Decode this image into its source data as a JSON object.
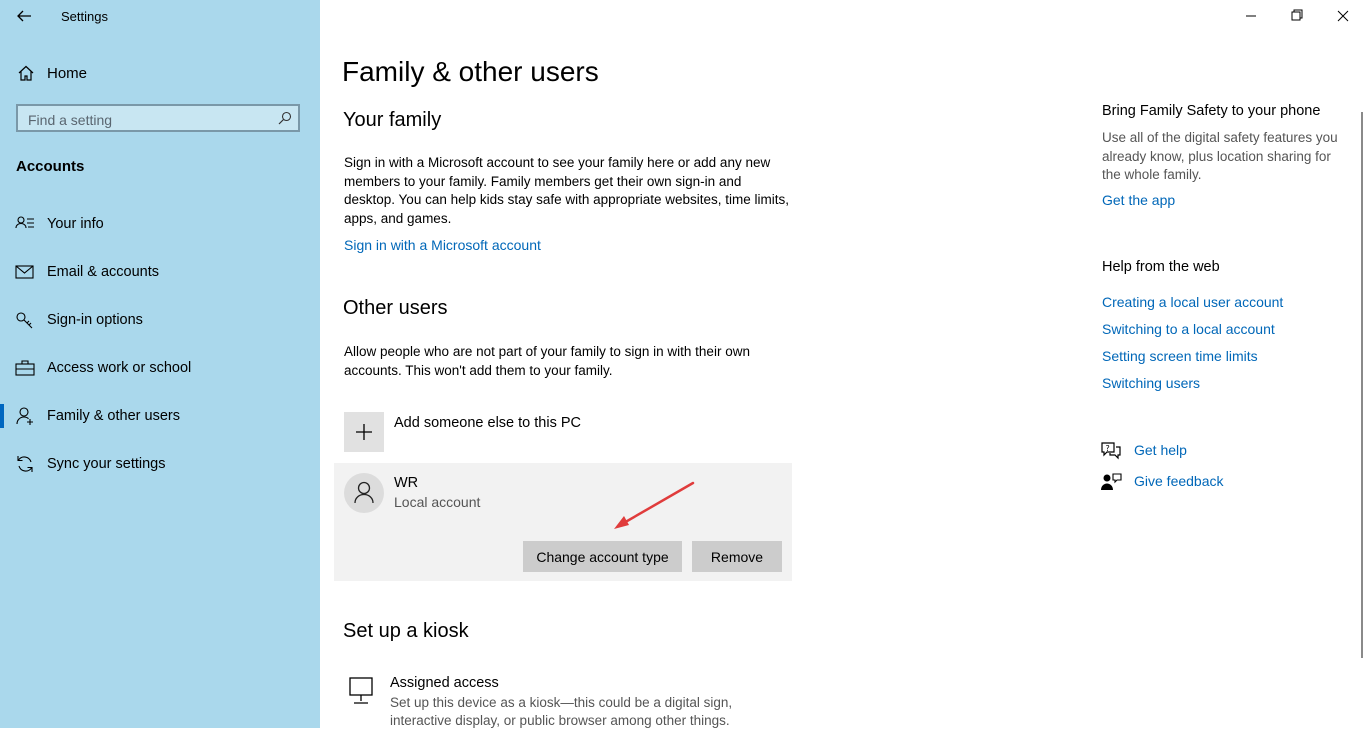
{
  "window": {
    "title": "Settings"
  },
  "sidebar": {
    "home_label": "Home",
    "search_placeholder": "Find a setting",
    "section": "Accounts",
    "items": [
      {
        "label": "Your info",
        "icon": "person-list-icon"
      },
      {
        "label": "Email & accounts",
        "icon": "mail-icon"
      },
      {
        "label": "Sign-in options",
        "icon": "key-icon"
      },
      {
        "label": "Access work or school",
        "icon": "briefcase-icon"
      },
      {
        "label": "Family & other users",
        "icon": "person-add-icon",
        "active": true
      },
      {
        "label": "Sync your settings",
        "icon": "sync-icon"
      }
    ]
  },
  "main": {
    "title": "Family & other users",
    "family": {
      "heading": "Your family",
      "description": "Sign in with a Microsoft account to see your family here or add any new members to your family. Family members get their own sign-in and desktop. You can help kids stay safe with appropriate websites, time limits, apps, and games.",
      "link": "Sign in with a Microsoft account"
    },
    "other_users": {
      "heading": "Other users",
      "description": "Allow people who are not part of your family to sign in with their own accounts. This won't add them to your family.",
      "add_label": "Add someone else to this PC",
      "user": {
        "name": "WR",
        "type": "Local account"
      },
      "change_button": "Change account type",
      "remove_button": "Remove"
    },
    "kiosk": {
      "heading": "Set up a kiosk",
      "title": "Assigned access",
      "description": "Set up this device as a kiosk—this could be a digital sign, interactive display, or public browser among other things."
    }
  },
  "right": {
    "safety_heading": "Bring Family Safety to your phone",
    "safety_text": "Use all of the digital safety features you already know, plus location sharing for the whole family.",
    "safety_link": "Get the app",
    "web_heading": "Help from the web",
    "web_links": [
      "Creating a local user account",
      "Switching to a local account",
      "Setting screen time limits",
      "Switching users"
    ],
    "get_help": "Get help",
    "give_feedback": "Give feedback"
  },
  "colors": {
    "sidebar_bg": "#aad8ec",
    "link": "#0067b8",
    "accent": "#0067c0",
    "annotation_arrow": "#e03c3c"
  }
}
